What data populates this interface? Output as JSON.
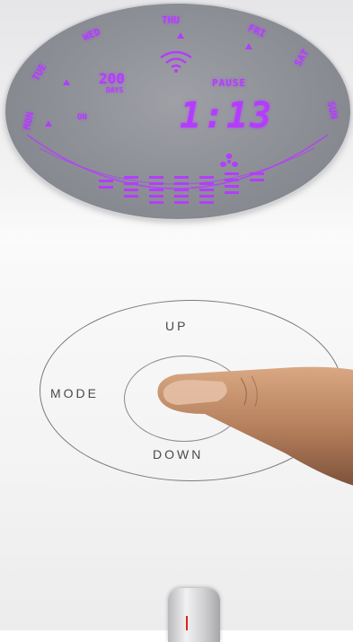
{
  "display": {
    "days_of_week": [
      "MON",
      "TUE",
      "WED",
      "THU",
      "FRI",
      "SAT",
      "SUN"
    ],
    "day_counter": "200",
    "days_label": "DAYS",
    "status": "PAUSE",
    "power_state": "ON",
    "time": "1:13",
    "segment_color": "#b43cff"
  },
  "control_pad": {
    "up_label": "UP",
    "mode_label": "MODE",
    "down_label": "DOWN"
  }
}
